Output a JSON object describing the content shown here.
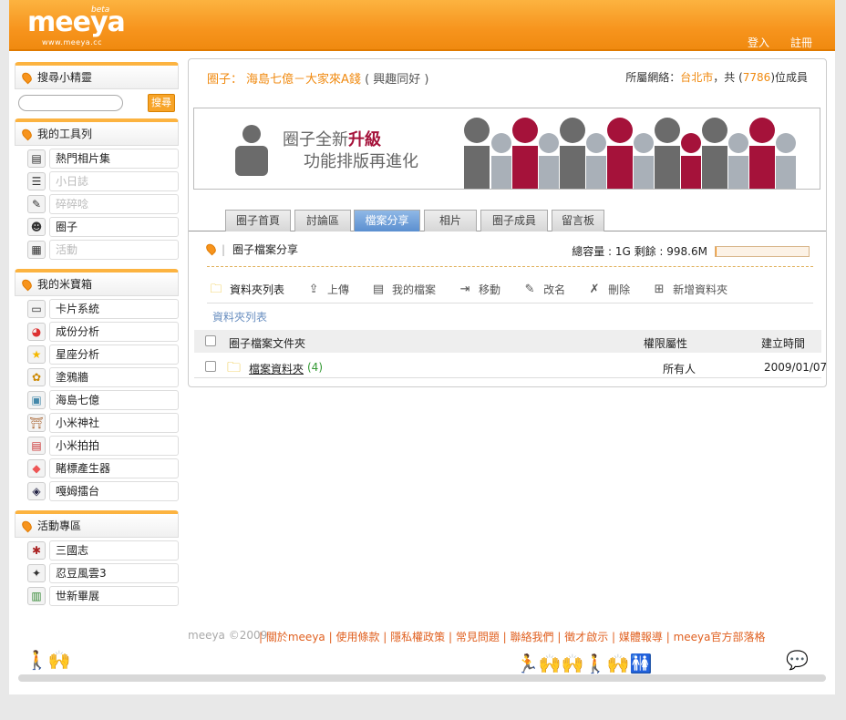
{
  "header": {
    "logo": "meeya",
    "logo_url": "www.meeya.cc",
    "beta": "beta",
    "login": "登入",
    "register": "註冊"
  },
  "sidebar": {
    "search_title": "搜尋小精靈",
    "search_button": "搜尋",
    "search_placeholder": "",
    "tools_title": "我的工具列",
    "tools": [
      {
        "label": "熱門相片集",
        "icon": "photo-album-icon"
      },
      {
        "label": "小日誌",
        "icon": "notebook-icon"
      },
      {
        "label": "碎碎唸",
        "icon": "pencil-icon"
      },
      {
        "label": "圈子",
        "icon": "group-icon"
      },
      {
        "label": "活動",
        "icon": "calendar-icon"
      }
    ],
    "treasure_title": "我的米寶箱",
    "treasure": [
      {
        "label": "卡片系統",
        "icon": "card-icon"
      },
      {
        "label": "成份分析",
        "icon": "pie-chart-icon"
      },
      {
        "label": "星座分析",
        "icon": "star-icon"
      },
      {
        "label": "塗鴉牆",
        "icon": "palette-icon"
      },
      {
        "label": "海島七億",
        "icon": "island-icon"
      },
      {
        "label": "小米神社",
        "icon": "shrine-icon"
      },
      {
        "label": "小米拍拍",
        "icon": "camera-icon"
      },
      {
        "label": "賭標產生器",
        "icon": "tag-icon"
      },
      {
        "label": "嘎姆擂台",
        "icon": "arena-icon"
      }
    ],
    "events_title": "活動專區",
    "events": [
      {
        "label": "三國志",
        "icon": "spider-icon"
      },
      {
        "label": "忍豆風雲3",
        "icon": "shuriken-icon"
      },
      {
        "label": "世新畢展",
        "icon": "film-icon"
      }
    ]
  },
  "group": {
    "label": "圈子：",
    "name": "海島七億－大家來A錢",
    "category": "( 興趣同好 )",
    "network_label": "所屬網絡：",
    "network": "台北市",
    "count_prefix": "，共 (",
    "count": "7786",
    "count_suffix": ")位成員"
  },
  "banner": {
    "line1a": "圈子全新",
    "line1b": "升級",
    "line2": "功能排版再進化"
  },
  "tabs": [
    "圈子首頁",
    "討論區",
    "檔案分享",
    "相片",
    "圈子成員",
    "留言板"
  ],
  "files": {
    "title": "圈子檔案分享",
    "quota": "總容量 : 1G 剩餘 : 998.6M",
    "quota_used_fraction": 0.0025,
    "tools": [
      {
        "label": "資料夾列表",
        "icon": "folder-icon"
      },
      {
        "label": "上傳",
        "icon": "upload-icon"
      },
      {
        "label": "我的檔案",
        "icon": "my-files-icon"
      },
      {
        "label": "移動",
        "icon": "move-icon"
      },
      {
        "label": "改名",
        "icon": "rename-icon"
      },
      {
        "label": "刪除",
        "icon": "delete-icon"
      },
      {
        "label": "新增資料夾",
        "icon": "new-folder-icon"
      }
    ],
    "breadcrumb": "資料夾列表",
    "columns": {
      "name": "圈子檔案文件夾",
      "perm": "權限屬性",
      "date": "建立時間"
    },
    "rows": [
      {
        "name": "檔案資料夾",
        "count": "(4)",
        "perm": "所有人",
        "date": "2009/01/07"
      }
    ]
  },
  "footer": {
    "copyright": "meeya ©2009",
    "links": [
      "關於meeya",
      "使用條款",
      "隱私權政策",
      "常見問題",
      "聯絡我們",
      "徵才啟示",
      "媒體報導",
      "meeya官方部落格"
    ]
  },
  "colors": {
    "orange": "#f7941d",
    "accent_red": "#a5123a",
    "link_blue": "#6a8fc0"
  }
}
